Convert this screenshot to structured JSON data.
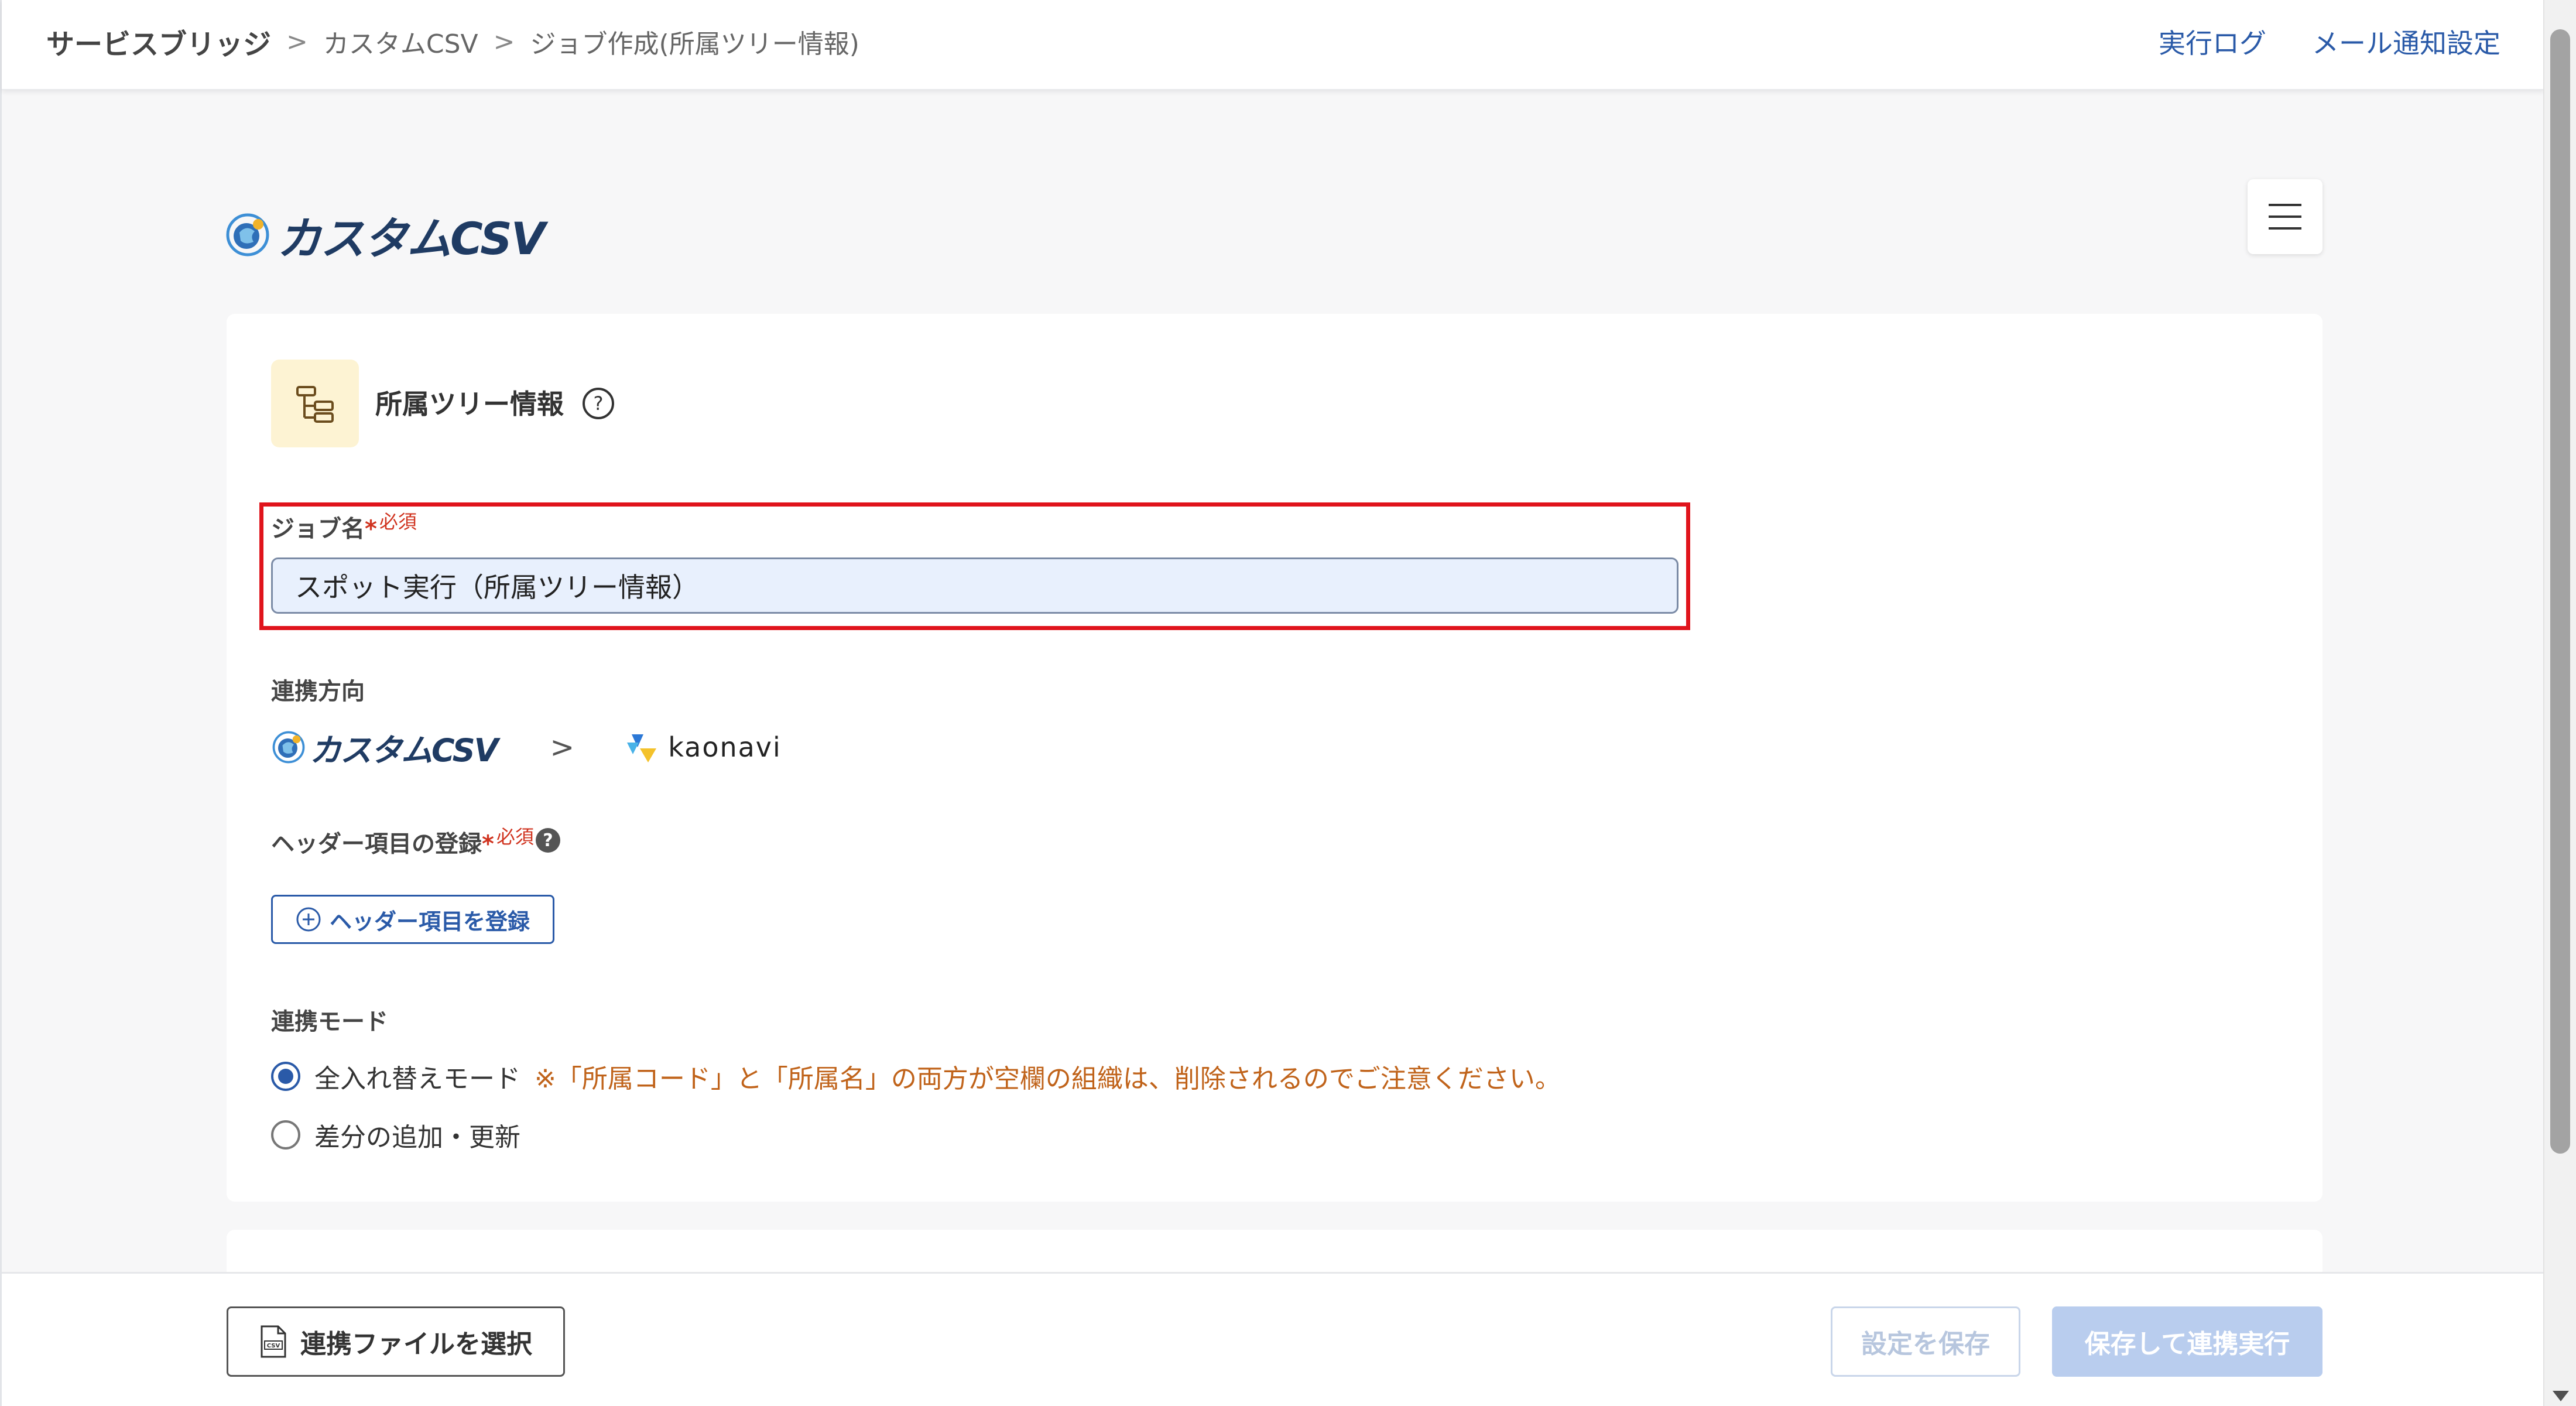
{
  "breadcrumb": {
    "items": [
      "サービスブリッジ",
      "カスタムCSV",
      "ジョブ作成(所属ツリー情報)"
    ],
    "separator": ">"
  },
  "top_links": {
    "log": "実行ログ",
    "mail": "メール通知設定"
  },
  "brand": {
    "name": "カスタムCSV"
  },
  "section": {
    "title": "所属ツリー情報",
    "help": "?"
  },
  "job_name": {
    "label": "ジョブ名",
    "required_mark": "*",
    "required_text": "必須",
    "value": "スポット実行（所属ツリー情報）"
  },
  "direction": {
    "label": "連携方向",
    "source": "カスタムCSV",
    "arrow": ">",
    "target": "kaonavi"
  },
  "header_items": {
    "label": "ヘッダー項目の登録",
    "required_mark": "*",
    "required_text": "必須",
    "help": "?",
    "button_label": "ヘッダー項目を登録"
  },
  "mode": {
    "label": "連携モード",
    "options": [
      {
        "label": "全入れ替えモード",
        "note": "※「所属コード」と「所属名」の両方が空欄の組織は、削除されるのでご注意ください。",
        "checked": true
      },
      {
        "label": "差分の追加・更新",
        "note": "",
        "checked": false
      }
    ]
  },
  "footer": {
    "file_button": "連携ファイルを選択",
    "save_button": "設定を保存",
    "run_button": "保存して連携実行"
  },
  "colors": {
    "accent": "#2a5aa8",
    "warning": "#c0631a",
    "highlight": "#e0141c",
    "disabled_fill": "#b9cdee"
  }
}
